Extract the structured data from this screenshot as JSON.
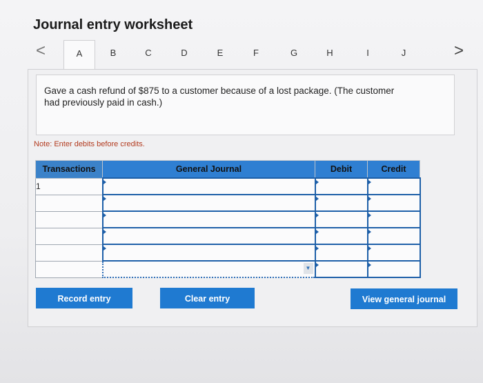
{
  "title": "Journal entry worksheet",
  "nav": {
    "prev": "<",
    "next": ">"
  },
  "tabs": [
    {
      "label": "A",
      "active": true
    },
    {
      "label": "B"
    },
    {
      "label": "C"
    },
    {
      "label": "D"
    },
    {
      "label": "E"
    },
    {
      "label": "F"
    },
    {
      "label": "G"
    },
    {
      "label": "H"
    },
    {
      "label": "I"
    },
    {
      "label": "J"
    }
  ],
  "question": "Gave a cash refund of $875 to a customer because of a lost package. (The customer had previously paid in cash.)",
  "note": "Note: Enter debits before credits.",
  "table": {
    "headers": [
      "Transactions",
      "General Journal",
      "Debit",
      "Credit"
    ],
    "rows": [
      {
        "transaction": "1",
        "account": "",
        "debit": "",
        "credit": ""
      },
      {
        "transaction": "",
        "account": "",
        "debit": "",
        "credit": ""
      },
      {
        "transaction": "",
        "account": "",
        "debit": "",
        "credit": ""
      },
      {
        "transaction": "",
        "account": "",
        "debit": "",
        "credit": ""
      },
      {
        "transaction": "",
        "account": "",
        "debit": "",
        "credit": ""
      },
      {
        "transaction": "",
        "account": "",
        "debit": "",
        "credit": ""
      }
    ]
  },
  "buttons": {
    "record": "Record entry",
    "clear": "Clear entry",
    "view": "View general journal"
  },
  "colors": {
    "accent": "#1f7ad1",
    "note": "#b23a1e"
  }
}
